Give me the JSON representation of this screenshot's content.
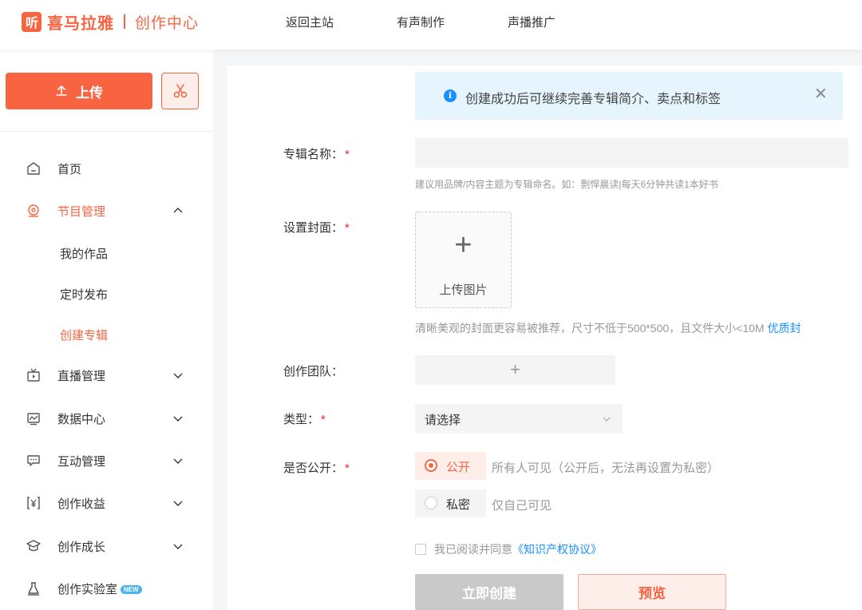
{
  "header": {
    "logo_mark": "听",
    "brand": "喜马拉雅",
    "sub_brand": "创作中心",
    "nav": [
      "返回主站",
      "有声制作",
      "声播推广"
    ]
  },
  "sidebar": {
    "upload_label": "上传",
    "menu": {
      "home": "首页",
      "program": "节目管理",
      "program_sub": [
        "我的作品",
        "定时发布",
        "创建专辑"
      ],
      "live": "直播管理",
      "data": "数据中心",
      "interact": "互动管理",
      "income": "创作收益",
      "growth": "创作成长",
      "lab": "创作实验室",
      "lab_badge": "NEW"
    }
  },
  "main": {
    "notice": "创建成功后可继续完善专辑简介、卖点和标签",
    "name_label": "专辑名称：",
    "name_value": "",
    "name_hint": "建议用品牌/内容主题为专辑命名。如：剽悍晨读|每天6分钟共读1本好书",
    "cover_label": "设置封面：",
    "cover_upload": "上传图片",
    "cover_hint": "清晰美观的封面更容易被推荐，尺寸不低于500*500，且文件大小<10M",
    "cover_hint_link": "优质封",
    "team_label": "创作团队：",
    "type_label": "类型：",
    "type_value": "请选择",
    "public_label": "是否公开：",
    "public_option": "公开",
    "public_desc": "所有人可见（公开后，无法再设置为私密）",
    "private_option": "私密",
    "private_desc": "仅自己可见",
    "agree_text": "我已阅读并同意",
    "agree_link": "《知识产权协议》",
    "create_btn": "立即创建",
    "preview_btn": "预览",
    "required_mark": "*"
  },
  "colors": {
    "brand": "#f86442",
    "link": "#1890ff",
    "notice_bg": "#e6f5fd"
  }
}
